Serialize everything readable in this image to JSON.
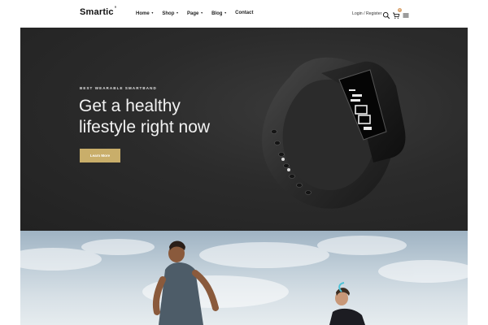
{
  "header": {
    "logo": "Smartic",
    "logo_mark": "°",
    "nav": [
      {
        "label": "Home",
        "caret": "▾"
      },
      {
        "label": "Shop",
        "caret": "▾"
      },
      {
        "label": "Page",
        "caret": "▾"
      },
      {
        "label": "Blog",
        "caret": "▾"
      },
      {
        "label": "Contact",
        "caret": ""
      }
    ],
    "login": "Login / Register",
    "cart_count": "0",
    "icons": [
      "search-icon",
      "cart-icon",
      "menu-icon"
    ]
  },
  "hero": {
    "eyebrow": "BEST WEARABLE SMARTBAND",
    "title_line1": "Get a healthy",
    "title_line2": "lifestyle right now",
    "button": "Learn More",
    "product_display": "12:00",
    "colors": {
      "background": "#2b2b2b",
      "button": "#c9ae6a",
      "title": "#f2f2f2"
    }
  }
}
